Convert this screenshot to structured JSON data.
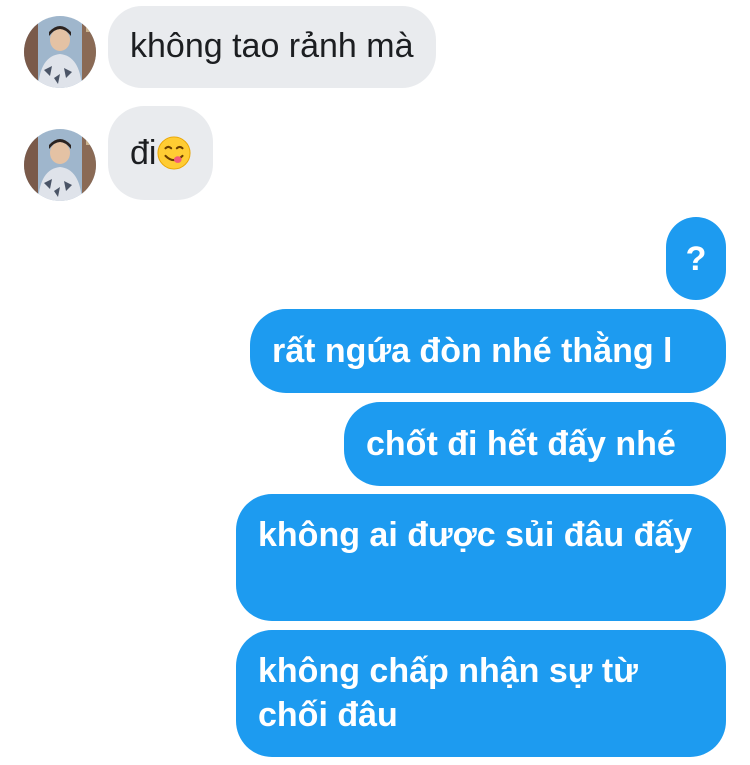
{
  "conversation": {
    "messages": [
      {
        "sender": "contact",
        "text": "không tao rảnh mà",
        "avatar_icon": "profile-photo"
      },
      {
        "sender": "contact",
        "text": "đi",
        "emoji": "smiling-face-savoring-food",
        "avatar_icon": "profile-photo"
      },
      {
        "sender": "me",
        "text": "?"
      },
      {
        "sender": "me",
        "text": "rất ngứa đòn nhé thằng l"
      },
      {
        "sender": "me",
        "text": "chốt đi hết đấy nhé"
      },
      {
        "sender": "me",
        "text": "không ai được sủi đâu đấy"
      },
      {
        "sender": "me",
        "text": "không chấp nhận sự từ chối đâu"
      }
    ]
  },
  "colors": {
    "incoming_bubble": "#e9ebee",
    "outgoing_bubble": "#1d9bf0",
    "incoming_text": "#1c1e21",
    "outgoing_text": "#ffffff"
  }
}
